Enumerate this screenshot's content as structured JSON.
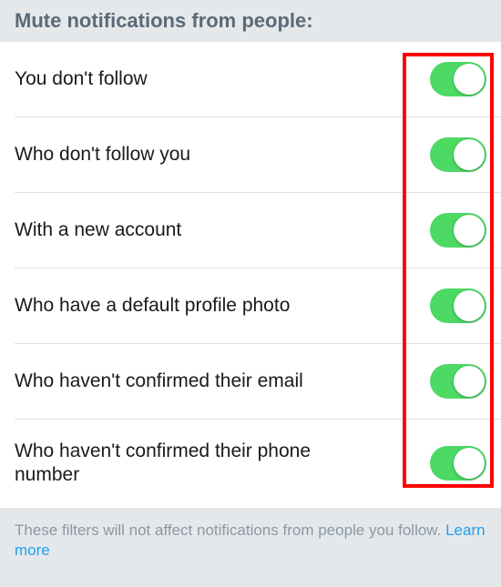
{
  "header": {
    "title": "Mute notifications from people:"
  },
  "rows": [
    {
      "label": "You don't follow",
      "on": true
    },
    {
      "label": "Who don't follow you",
      "on": true
    },
    {
      "label": "With a new account",
      "on": true
    },
    {
      "label": "Who have a default profile photo",
      "on": true
    },
    {
      "label": "Who haven't confirmed their email",
      "on": true
    },
    {
      "label": "Who haven't confirmed their phone number",
      "on": true
    }
  ],
  "footer": {
    "text": "These filters will not affect notifications from people you follow. ",
    "link_text": "Learn more"
  }
}
